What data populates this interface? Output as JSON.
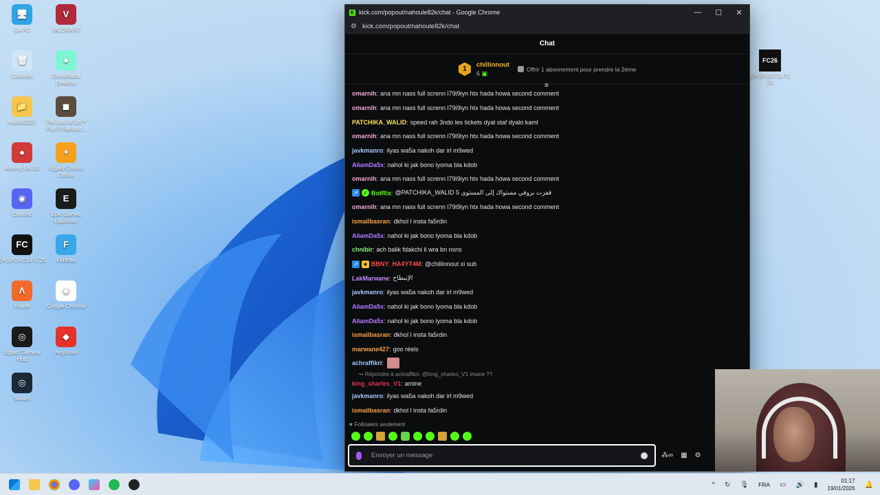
{
  "desktop": {
    "icons_left": [
      {
        "label": "Ce PC",
        "color": "#2fa4e7",
        "glyph": "🖥"
      },
      {
        "label": "VALORANT",
        "color": "#b02a3b",
        "glyph": "V"
      },
      {
        "label": "Corbeille",
        "color": "#cfe5f7",
        "glyph": "🗑"
      },
      {
        "label": "Streamlabs Desktop",
        "color": "#80f5d2",
        "glyph": "●"
      },
      {
        "label": "maroc2025",
        "color": "#f4c64b",
        "glyph": "📁"
      },
      {
        "label": "The Last of Us™ Part II Remast...",
        "color": "#5a4c3e",
        "glyph": "◼"
      },
      {
        "label": "Among Us 3D",
        "color": "#d23a3a",
        "glyph": "●"
      },
      {
        "label": "Elgato Control Center",
        "color": "#f7a11a",
        "glyph": "☀"
      },
      {
        "label": "Discord",
        "color": "#5865f2",
        "glyph": "◉"
      },
      {
        "label": "Epic Games Launcher",
        "color": "#1b1b1b",
        "glyph": "E"
      },
      {
        "label": "EA SPORTS FC 25",
        "color": "#111",
        "glyph": "FC"
      },
      {
        "label": "Fortnite",
        "color": "#39a7e8",
        "glyph": "F"
      },
      {
        "label": "FiveM",
        "color": "#f26a2a",
        "glyph": "Λ"
      },
      {
        "label": "Google Chrome",
        "color": "#ffffff",
        "glyph": "◉"
      },
      {
        "label": "Elgato Camera Hub",
        "color": "#1a1a1a",
        "glyph": "◎"
      },
      {
        "label": "AnyDesk",
        "color": "#e5332a",
        "glyph": "◆"
      },
      {
        "label": "Steam",
        "color": "#1b2838",
        "glyph": "◎"
      }
    ],
    "icon_right": {
      "label": "EA SPORTS FC 26",
      "tile_text": "FC26"
    }
  },
  "window": {
    "title": "kick.com/popout/nahoule82k/chat - Google Chrome",
    "url": "kick.com/popout/nahoule82k/chat",
    "chat_header": "Chat",
    "pinned": {
      "rank": "1",
      "username": "chillinnout",
      "count": "6",
      "gift_text": "Offrir 1 abonnement pour prendre la 2ème"
    }
  },
  "messages": [
    {
      "user": "omarnih",
      "color": "#f3a9d7",
      "text": "ana mn nass full screnn l79i9iyn htx hada howa second comment",
      "badges": []
    },
    {
      "user": "omarnih",
      "color": "#f3a9d7",
      "text": "ana mn nass full screnn l79i9iyn htx hada howa second comment",
      "badges": []
    },
    {
      "user": "PATCHIKA_WALID",
      "color": "#f5e25d",
      "text": "speed rah 3ndo les tickets dyal staf dyalo kaml",
      "badges": []
    },
    {
      "user": "omarnih",
      "color": "#f3a9d7",
      "text": "ana mn nass full screnn l79i9iyn htx hada howa second comment",
      "badges": []
    },
    {
      "user": "javkmanro",
      "color": "#a7c7ff",
      "text": "ilyas wa5a nakoh dar irl m9wed",
      "badges": []
    },
    {
      "user": "AliamDa5x",
      "color": "#b57bff",
      "text": "nahol ki jak bono lyoma bla kdob",
      "badges": []
    },
    {
      "user": "omarnih",
      "color": "#f3a9d7",
      "text": "ana mn nass full screnn l79i9iyn htx hada howa second comment",
      "badges": []
    },
    {
      "user": "BotRix",
      "color": "#53fc18",
      "text": "@PATCHIKA_WALID قفزت بروفي مستواك إلى المستوى 5",
      "badges": [
        "blue",
        "green"
      ]
    },
    {
      "user": "omarnih",
      "color": "#f3a9d7",
      "text": "ana mn nass full screnn l79i9iyn htx hada howa second comment",
      "badges": []
    },
    {
      "user": "ismailbasran",
      "color": "#f9a14a",
      "text": "dkhol l insta fa5rdin",
      "badges": []
    },
    {
      "user": "AliamDa5x",
      "color": "#b57bff",
      "text": "nahol ki jak bono lyoma bla kdob",
      "badges": []
    },
    {
      "user": "chnibir",
      "color": "#8df27f",
      "text": "ach balik fdakchi li wra bn nsns",
      "badges": []
    },
    {
      "user": "BBNY_HA4YT4M",
      "color": "#ff4a4a",
      "text": "@chillinnout xi sub",
      "badges": [
        "blue",
        "gold"
      ]
    },
    {
      "user": "LakMarwane",
      "color": "#c78bff",
      "text": "الإنبطاح",
      "badges": []
    },
    {
      "user": "javkmanro",
      "color": "#a7c7ff",
      "text": "ilyas wa5a nakoh dar irl m9wed",
      "badges": []
    },
    {
      "user": "AliamDa5x",
      "color": "#b57bff",
      "text": "nahol ki jak bono lyoma bla kdob",
      "badges": []
    },
    {
      "user": "AliamDa5x",
      "color": "#b57bff",
      "text": "nahol ki jak bono lyoma bla kdob",
      "badges": []
    },
    {
      "user": "ismailbasran",
      "color": "#f9a14a",
      "text": "dkhol l insta fa5rdin",
      "badges": []
    },
    {
      "user": "marwane427",
      "color": "#f9a14a",
      "text": "goo réels",
      "badges": []
    },
    {
      "user": "achraffikri",
      "color": "#a7c7ff",
      "text": "",
      "emote": true,
      "badges": []
    }
  ],
  "reply": {
    "text": "↪ Répondre à achraffikri: @king_sharles_V1 imane ??",
    "user": "king_sharles_V1",
    "color": "#e0345a",
    "msg": "amine"
  },
  "messages_after": [
    {
      "user": "javkmanro",
      "color": "#a7c7ff",
      "text": "ilyas wa5a nakoh dar irl m9wed"
    },
    {
      "user": "ismailbasran",
      "color": "#f9a14a",
      "text": "dkhol l insta fa5rdin"
    }
  ],
  "followers_only": "Followers seulement",
  "input": {
    "placeholder": "Envoyer un message",
    "value": ""
  },
  "taskbar": {
    "language": "FRA",
    "time": "01:17",
    "date": "19/01/2026"
  }
}
